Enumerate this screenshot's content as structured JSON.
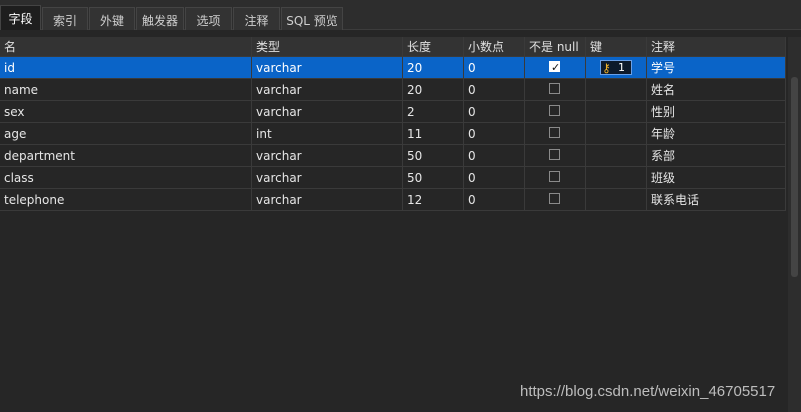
{
  "tabs": [
    {
      "label": "字段",
      "active": true
    },
    {
      "label": "索引",
      "active": false
    },
    {
      "label": "外键",
      "active": false
    },
    {
      "label": "触发器",
      "active": false
    },
    {
      "label": "选项",
      "active": false
    },
    {
      "label": "注释",
      "active": false
    },
    {
      "label": "SQL 预览",
      "active": false
    }
  ],
  "table": {
    "columns": [
      "名",
      "类型",
      "长度",
      "小数点",
      "不是 null",
      "键",
      "注释"
    ],
    "rows": [
      {
        "name": "id",
        "type": "varchar",
        "length": "20",
        "decimals": "0",
        "not_null": true,
        "key": "1",
        "comment": "学号",
        "selected": true
      },
      {
        "name": "name",
        "type": "varchar",
        "length": "20",
        "decimals": "0",
        "not_null": false,
        "key": "",
        "comment": "姓名",
        "selected": false
      },
      {
        "name": "sex",
        "type": "varchar",
        "length": "2",
        "decimals": "0",
        "not_null": false,
        "key": "",
        "comment": "性别",
        "selected": false
      },
      {
        "name": "age",
        "type": "int",
        "length": "11",
        "decimals": "0",
        "not_null": false,
        "key": "",
        "comment": "年龄",
        "selected": false
      },
      {
        "name": "department",
        "type": "varchar",
        "length": "50",
        "decimals": "0",
        "not_null": false,
        "key": "",
        "comment": "系部",
        "selected": false
      },
      {
        "name": "class",
        "type": "varchar",
        "length": "50",
        "decimals": "0",
        "not_null": false,
        "key": "",
        "comment": "班级",
        "selected": false
      },
      {
        "name": "telephone",
        "type": "varchar",
        "length": "12",
        "decimals": "0",
        "not_null": false,
        "key": "",
        "comment": "联系电话",
        "selected": false
      }
    ]
  },
  "icons": {
    "key": "key-icon",
    "checkbox_check": "check-icon"
  },
  "colors": {
    "selection": "#0a64c8",
    "key_icon": "#f1b32a",
    "background": "#262626"
  },
  "watermark": "https://blog.csdn.net/weixin_46705517"
}
